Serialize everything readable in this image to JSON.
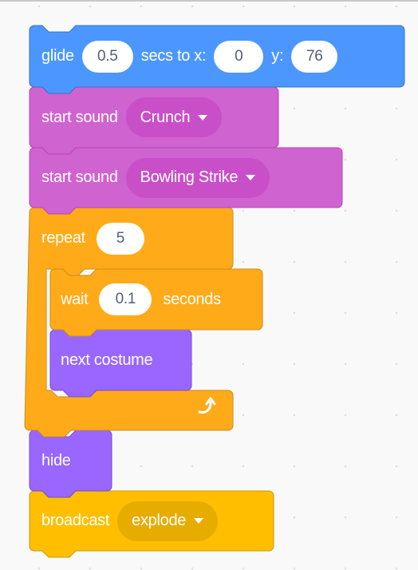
{
  "colors": {
    "motion": "#4c97ff",
    "sound": "#cf63cf",
    "sound_dropdown": "#c94fc9",
    "control": "#ffab19",
    "looks": "#9966ff",
    "events": "#ffbf00",
    "events_dropdown": "#e6ac00",
    "field_text": "#575e75",
    "canvas": "#f9f9f9"
  },
  "script": {
    "glide": {
      "label_1": "glide",
      "secs": "0.5",
      "label_2": "secs to x:",
      "x": "0",
      "label_3": "y:",
      "y": "76"
    },
    "sound_1": {
      "label": "start sound",
      "value": "Crunch"
    },
    "sound_2": {
      "label": "start sound",
      "value": "Bowling Strike"
    },
    "repeat": {
      "label": "repeat",
      "times": "5"
    },
    "wait": {
      "label_1": "wait",
      "value": "0.1",
      "label_2": "seconds"
    },
    "next_costume": {
      "label": "next costume"
    },
    "hide": {
      "label": "hide"
    },
    "broadcast": {
      "label": "broadcast",
      "value": "explode"
    }
  }
}
